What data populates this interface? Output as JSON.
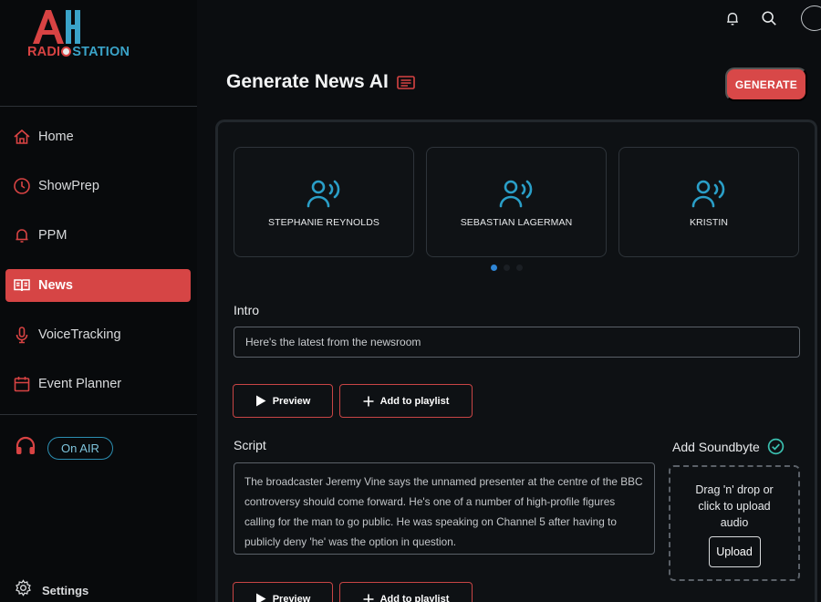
{
  "brand": {
    "logo_text_left": "RADI",
    "logo_text_right": "STATION",
    "colors": {
      "red": "#d84343",
      "blue": "#3aa3c8"
    }
  },
  "sidebar": {
    "items": [
      {
        "label": "Home",
        "icon": "home-icon"
      },
      {
        "label": "ShowPrep",
        "icon": "clock-icon"
      },
      {
        "label": "PPM",
        "icon": "bell-icon"
      },
      {
        "label": "News",
        "icon": "book-icon",
        "active": true
      },
      {
        "label": "VoiceTracking",
        "icon": "microphone-icon"
      },
      {
        "label": "Event Planner",
        "icon": "calendar-icon"
      }
    ],
    "on_air_label": "On AIR",
    "settings_label": "Settings"
  },
  "topbar": {
    "icons": [
      "bell-icon",
      "search-icon",
      "avatar"
    ]
  },
  "header": {
    "title": "Generate News AI",
    "generate_label": "GENERATE"
  },
  "presenters": [
    {
      "name": "STEPHANIE REYNOLDS"
    },
    {
      "name": "SEBASTIAN LAGERMAN"
    },
    {
      "name": "KRISTIN"
    }
  ],
  "carousel": {
    "active_index": 0,
    "dot_count": 3
  },
  "intro": {
    "label": "Intro",
    "value": "Here's the latest from the newsroom",
    "preview_label": "Preview",
    "playlist_label": "Add to playlist"
  },
  "script": {
    "label": "Script",
    "text": "The broadcaster Jeremy Vine says the unnamed presenter at the centre of the BBC controversy should come forward. He's one of a number of high-profile figures calling for the man to go public. He was speaking on Channel 5 after having to publicly deny 'he' was the option in question.",
    "preview_label": "Preview",
    "playlist_label": "Add to playlist"
  },
  "soundbyte": {
    "label": "Add Soundbyte",
    "drop_text": "Drag 'n' drop or click to upload audio",
    "upload_label": "Upload"
  }
}
